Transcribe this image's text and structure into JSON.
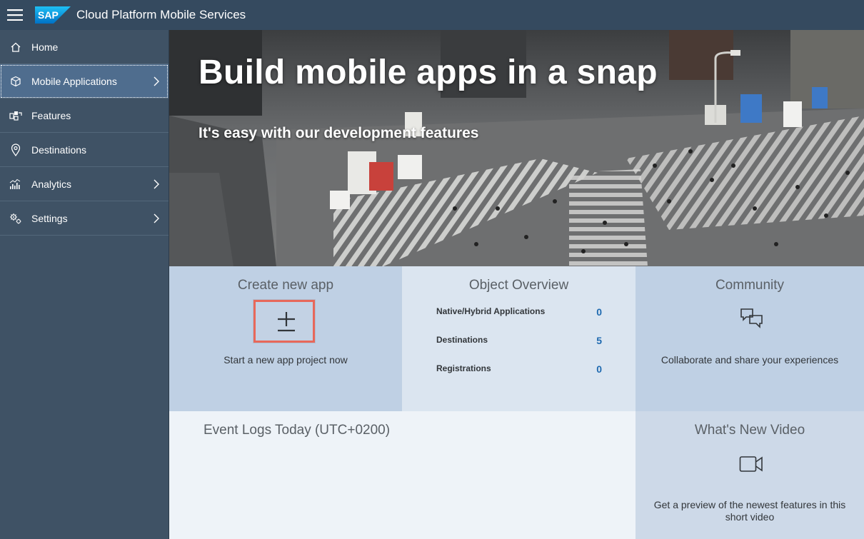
{
  "shell": {
    "brand": "SAP",
    "title": "Cloud Platform Mobile Services"
  },
  "sidebar": {
    "items": [
      {
        "label": "Home",
        "icon": "home-icon"
      },
      {
        "label": "Mobile Applications",
        "icon": "cube-icon",
        "has_children": true,
        "active": true
      },
      {
        "label": "Features",
        "icon": "features-icon"
      },
      {
        "label": "Destinations",
        "icon": "map-pin-icon"
      },
      {
        "label": "Analytics",
        "icon": "analytics-icon",
        "has_children": true
      },
      {
        "label": "Settings",
        "icon": "settings-gears-icon",
        "has_children": true
      }
    ]
  },
  "hero": {
    "title": "Build mobile apps in a snap",
    "subtitle": "It's easy with our development features"
  },
  "tiles": {
    "create": {
      "title": "Create new app",
      "description": "Start a new app project now"
    },
    "overview": {
      "title": "Object Overview",
      "rows": [
        {
          "label": "Native/Hybrid Applications",
          "value": "0"
        },
        {
          "label": "Destinations",
          "value": "5"
        },
        {
          "label": "Registrations",
          "value": "0"
        }
      ]
    },
    "community": {
      "title": "Community",
      "description": "Collaborate and share your experiences"
    },
    "logs": {
      "title": "Event Logs Today (UTC+0200)"
    },
    "video": {
      "title": "What's New Video",
      "description": "Get a preview of the newest features in this short video"
    }
  },
  "colors": {
    "shell_bg": "#354a5f",
    "nav_bg": "#3f5265",
    "nav_active": "#4f6d8e",
    "tile_blue": "#bfd0e4",
    "tile_light": "#dbe5f0",
    "link_blue": "#1f6ab0",
    "highlight": "#e8685a"
  }
}
